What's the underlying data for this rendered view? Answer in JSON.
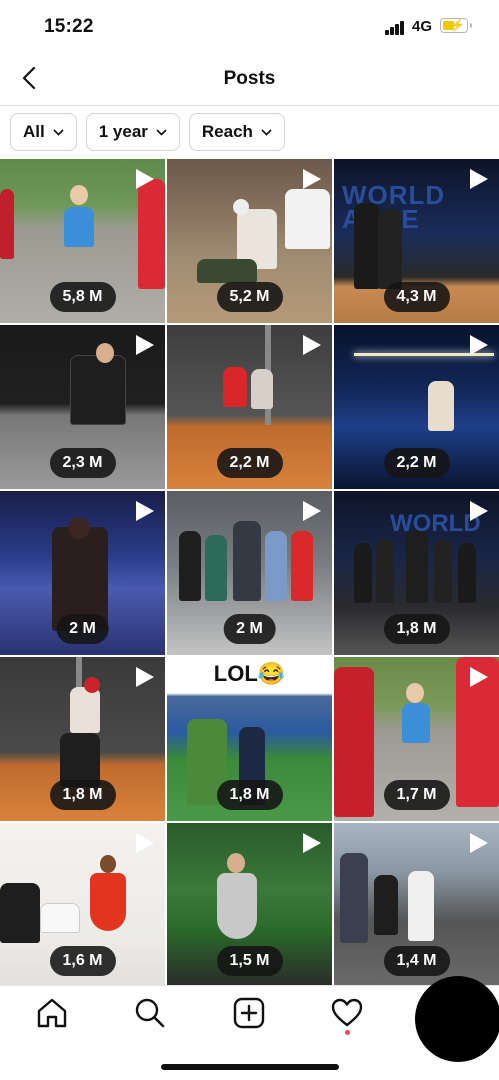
{
  "status": {
    "time": "15:22",
    "network": "4G"
  },
  "nav": {
    "title": "Posts"
  },
  "filters": [
    {
      "label": "All"
    },
    {
      "label": "1 year"
    },
    {
      "label": "Reach"
    }
  ],
  "posts": [
    {
      "views": "5,8 M"
    },
    {
      "views": "5,2 M"
    },
    {
      "views": "4,3 M"
    },
    {
      "views": "2,3 M"
    },
    {
      "views": "2,2 M"
    },
    {
      "views": "2,2 M"
    },
    {
      "views": "2 M"
    },
    {
      "views": "2 M"
    },
    {
      "views": "1,8 M"
    },
    {
      "views": "1,8 M"
    },
    {
      "views": "1,8 M",
      "caption": "LOL😂"
    },
    {
      "views": "1,7 M"
    },
    {
      "views": "1,6 M"
    },
    {
      "views": "1,5 M"
    },
    {
      "views": "1,4 M"
    }
  ],
  "colors": {
    "badge_bg": "#141414",
    "notification": "#ed4956",
    "battery": "#f4c800"
  },
  "tabbar": {
    "icons": [
      "home-icon",
      "search-icon",
      "new-post-icon",
      "activity-heart-icon",
      "profile"
    ]
  }
}
